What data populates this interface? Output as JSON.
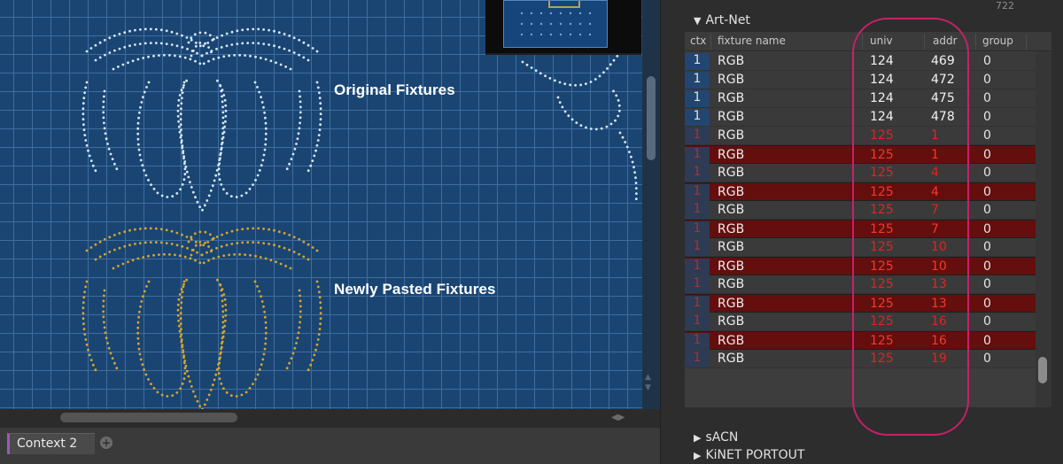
{
  "canvas": {
    "labels": {
      "original": "Original Fixtures",
      "pasted": "Newly Pasted Fixtures"
    },
    "colors": {
      "background": "#1a4573",
      "grid": "#3d6d9f",
      "original_dots": "#d8e8f4",
      "pasted_dots": "#d9a62a"
    }
  },
  "context_bar": {
    "tab_label": "Context 2",
    "add_icon": "plus-icon"
  },
  "right_panel": {
    "count": "722",
    "sections": {
      "artnet": "Art-Net",
      "sacn": "sACN",
      "kinet": "KiNET PORTOUT"
    },
    "table": {
      "columns": [
        "ctx",
        "fixture name",
        "univ",
        "addr",
        "group"
      ],
      "rows": [
        {
          "ctx": "1",
          "name": "RGB",
          "univ": "124",
          "addr": "469",
          "group": "0",
          "state": "normal"
        },
        {
          "ctx": "1",
          "name": "RGB",
          "univ": "124",
          "addr": "472",
          "group": "0",
          "state": "normal"
        },
        {
          "ctx": "1",
          "name": "RGB",
          "univ": "124",
          "addr": "475",
          "group": "0",
          "state": "normal"
        },
        {
          "ctx": "1",
          "name": "RGB",
          "univ": "124",
          "addr": "478",
          "group": "0",
          "state": "normal"
        },
        {
          "ctx": "1",
          "name": "RGB",
          "univ": "125",
          "addr": "1",
          "group": "0",
          "state": "conflict"
        },
        {
          "ctx": "1",
          "name": "RGB",
          "univ": "125",
          "addr": "1",
          "group": "0",
          "state": "selected"
        },
        {
          "ctx": "1",
          "name": "RGB",
          "univ": "125",
          "addr": "4",
          "group": "0",
          "state": "conflict"
        },
        {
          "ctx": "1",
          "name": "RGB",
          "univ": "125",
          "addr": "4",
          "group": "0",
          "state": "selected"
        },
        {
          "ctx": "1",
          "name": "RGB",
          "univ": "125",
          "addr": "7",
          "group": "0",
          "state": "conflict"
        },
        {
          "ctx": "1",
          "name": "RGB",
          "univ": "125",
          "addr": "7",
          "group": "0",
          "state": "selected"
        },
        {
          "ctx": "1",
          "name": "RGB",
          "univ": "125",
          "addr": "10",
          "group": "0",
          "state": "conflict"
        },
        {
          "ctx": "1",
          "name": "RGB",
          "univ": "125",
          "addr": "10",
          "group": "0",
          "state": "selected"
        },
        {
          "ctx": "1",
          "name": "RGB",
          "univ": "125",
          "addr": "13",
          "group": "0",
          "state": "conflict"
        },
        {
          "ctx": "1",
          "name": "RGB",
          "univ": "125",
          "addr": "13",
          "group": "0",
          "state": "selected"
        },
        {
          "ctx": "1",
          "name": "RGB",
          "univ": "125",
          "addr": "16",
          "group": "0",
          "state": "conflict"
        },
        {
          "ctx": "1",
          "name": "RGB",
          "univ": "125",
          "addr": "16",
          "group": "0",
          "state": "selected"
        },
        {
          "ctx": "1",
          "name": "RGB",
          "univ": "125",
          "addr": "19",
          "group": "0",
          "state": "conflict"
        }
      ]
    },
    "highlight_color": "#c8206a"
  }
}
